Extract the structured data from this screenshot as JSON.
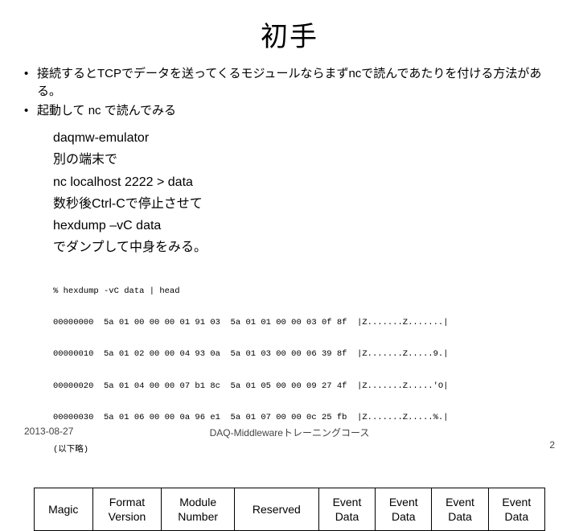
{
  "title": "初手",
  "bullets": [
    "接続するとTCPでデータを送ってくるモジュールならまずncで読んであたりを付ける方法がある。",
    "起動して nc で読んでみる"
  ],
  "steps": [
    "daqmw-emulator",
    "別の端末で",
    "nc localhost 2222 > data",
    "数秒後Ctrl-Cで停止させて",
    "hexdump –vC data",
    "でダンプして中身をみる。"
  ],
  "hexdump": [
    "% hexdump -vC data | head",
    "00000000  5a 01 00 00 00 01 91 03  5a 01 01 00 00 03 0f 8f  |Z.......Z.......|",
    "00000010  5a 01 02 00 00 04 93 0a  5a 01 03 00 00 06 39 8f  |Z.......Z.....9.|",
    "00000020  5a 01 04 00 00 07 b1 8c  5a 01 05 00 00 09 27 4f  |Z.......Z.....'O|",
    "00000030  5a 01 06 00 00 0a 96 e1  5a 01 07 00 00 0c 25 fb  |Z.......Z.....%.|",
    "(以下略)"
  ],
  "format_cells": [
    "Magic",
    "Format\nVersion",
    "Module\nNumber",
    "Reserved",
    "Event\nData",
    "Event\nData",
    "Event\nData",
    "Event\nData"
  ],
  "footer": {
    "date": "2013-08-27",
    "center": "DAQ-Middlewareトレーニングコース",
    "page": "2"
  }
}
